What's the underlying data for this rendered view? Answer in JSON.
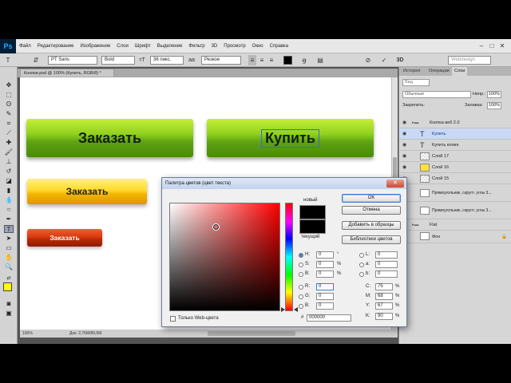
{
  "menubar": {
    "logo": "Ps",
    "items": [
      "Файл",
      "Редактирование",
      "Изображение",
      "Слои",
      "Шрифт",
      "Выделение",
      "Фильтр",
      "3D",
      "Просмотр",
      "Окно",
      "Справка"
    ]
  },
  "options": {
    "font_family": "PT Sans",
    "font_style": "Bold",
    "font_size": "36 пикс.",
    "antialias": "Резкое",
    "workspace": "Webdesign",
    "threeD_label": "3D"
  },
  "document": {
    "tab_title": "Кнопки.psd @ 100% (Купить, RGB/8) *",
    "zoom": "100%",
    "doc_info": "Док: 2,75М/89,6М",
    "buttons": {
      "order_big": "Заказать",
      "buy_big": "Купить",
      "order_medium": "Заказать",
      "order_small": "Заказать"
    }
  },
  "panel": {
    "tabs": [
      "История",
      "Операции",
      "Слои"
    ],
    "search_placeholder": "Вид",
    "blend_mode": "Обычные",
    "opacity_label": "Непр.:",
    "opacity": "100%",
    "lock_label": "Закрепить:",
    "fill_label": "Заливка:",
    "fill": "100%",
    "layers": [
      {
        "name": "Кнопка веб 2.0",
        "kind": "folder"
      },
      {
        "name": "Купить",
        "kind": "text"
      },
      {
        "name": "Купить копия",
        "kind": "text"
      },
      {
        "name": "Слой 17",
        "kind": "pixel"
      },
      {
        "name": "Слой 16",
        "kind": "pixel"
      },
      {
        "name": "Слой 15",
        "kind": "pixel"
      },
      {
        "name": "Прямоугольник, скругл. углы 3...",
        "kind": "shape"
      },
      {
        "name": "Прямоугольник, скругл. углы 3...",
        "kind": "shape"
      },
      {
        "name": "Flat",
        "kind": "folder"
      },
      {
        "name": "Фон",
        "kind": "pixel"
      }
    ]
  },
  "picker": {
    "title": "Палитра цветов (цвет текста)",
    "close_glyph": "✕",
    "new_label": "новый",
    "current_label": "текущий",
    "ok": "OK",
    "cancel": "Отмена",
    "add_swatch": "Добавить в образцы",
    "libraries": "Библиотеки цветов",
    "web_only": "Только Web-цвета",
    "current_color": "#000000",
    "H": {
      "label": "H:",
      "value": "0",
      "unit": "°"
    },
    "S": {
      "label": "S:",
      "value": "0",
      "unit": "%"
    },
    "B": {
      "label": "B:",
      "value": "0",
      "unit": "%"
    },
    "R": {
      "label": "R:",
      "value": "0"
    },
    "G": {
      "label": "G:",
      "value": "0"
    },
    "Bl": {
      "label": "B:",
      "value": "0"
    },
    "L": {
      "label": "L:",
      "value": "0"
    },
    "a": {
      "label": "a:",
      "value": "0"
    },
    "b": {
      "label": "b:",
      "value": "0"
    },
    "C": {
      "label": "C:",
      "value": "75",
      "unit": "%"
    },
    "M": {
      "label": "M:",
      "value": "68",
      "unit": "%"
    },
    "Y": {
      "label": "Y:",
      "value": "67",
      "unit": "%"
    },
    "K": {
      "label": "K:",
      "value": "90",
      "unit": "%"
    },
    "hex_label": "#",
    "hex": "000000"
  },
  "colors": {
    "green": "#7fc31a",
    "yellow": "#ffd92c",
    "red": "#d83a10",
    "foreground": "#ffff00",
    "background": "#ff3300"
  }
}
